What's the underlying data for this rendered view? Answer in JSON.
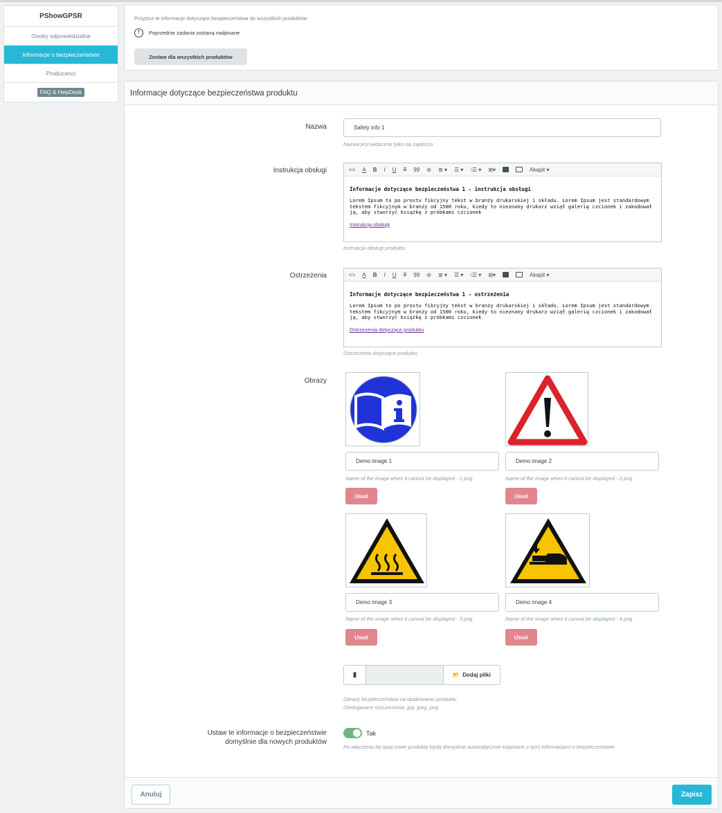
{
  "sidebar": {
    "brand": "PShowGPSR",
    "items": [
      {
        "label": "Osoby odpowiedzialne"
      },
      {
        "label": "Informacje o bezpieczeństwie",
        "active": true
      },
      {
        "label": "Producenci"
      }
    ],
    "faq": "FAQ & HelpDesk"
  },
  "top_card": {
    "info": "Przypisz te informacje dotyczące bezpieczeństwa do wszystkich produktów",
    "warning": "Poprzednie zadania zostaną nadpisane",
    "button": "Zestaw dla wszystkich produktów"
  },
  "form": {
    "title": "Informacje dotyczące bezpieczeństwa produktu",
    "name": {
      "label": "Nazwa",
      "value": "Safety info 1",
      "help": "Nazwa jest widoczna tylko na zapleczu"
    },
    "toolbar": {
      "code": "<>",
      "color": "A",
      "bold": "B",
      "italic": "I",
      "underline": "U",
      "strike": "T",
      "quote": "99",
      "link": "⊖",
      "align": "≣ ▾",
      "ul": "☰ ▾",
      "ol": "⁝☰ ▾",
      "table": "⊞▾",
      "paragraph": "Akapit ▾"
    },
    "instructions": {
      "label": "Instrukcja obsługi",
      "heading": "Informacje dotyczące bezpieczeństwa 1 - instrukcja obsługi",
      "text": "Lorem Ipsum to po prostu fikcyjny tekst w branży drukarskiej i składu. Lorem Ipsum jest standardowym tekstem fikcyjnym w branży od 1500 roku, kiedy to nieznany drukarz wziął galerię czcionek i zakodował ją, aby stworzyć książkę z próbkami czcionek",
      "link": "Instrukcja obsługi",
      "help": "Instrukcja obsługi produktu"
    },
    "warnings": {
      "label": "Ostrzeżenia",
      "heading": "Informacje dotyczące bezpieczeństwa 1 - ostrzeżenia",
      "text": "Lorem Ipsum to po prostu fikcyjny tekst w branży drukarskiej i składu. Lorem Ipsum jest standardowym tekstem fikcyjnym w branży od 1500 roku, kiedy to nieznany drukarz wziął galerię czcionek i zakodował ją, aby stworzyć książkę z próbkami czcionek",
      "link": "Ostrzeżenia dotyczące produktu",
      "help": "Ostrzeżenia dotyczące produktu"
    },
    "images": {
      "label": "Obrazy",
      "delete_label": "Usuń",
      "items": [
        {
          "alt": "Demo image 1",
          "help": "Name of the image when it cannot be displayed - 1.png",
          "icon": "manual-info-icon"
        },
        {
          "alt": "Demo image 2",
          "help": "Name of the image when it cannot be displayed - 2.png",
          "icon": "warning-triangle-icon"
        },
        {
          "alt": "Demo image 3",
          "help": "Name of the image when it cannot be displayed - 3.png",
          "icon": "hot-surface-icon"
        },
        {
          "alt": "Demo image 4",
          "help": "Name of the image when it cannot be displayed - 4.png",
          "icon": "hand-crush-icon"
        }
      ],
      "add_files": "Dodaj pliki",
      "help_1": "Obrazy bezpieczeństwa na opakowaniu produktu",
      "help_2": "Obsługiwane rozszerzenia: jpg, jpeg, png"
    },
    "default": {
      "label_1": "Ustaw te informacje o bezpieczeństwie",
      "label_2": "domyślnie dla nowych produktów",
      "value": true,
      "value_label": "Tak",
      "help": "Po włączeniu tej opcji nowe produkty będą domyślnie automatycznie kojarzone z tymi informacjami o bezpieczeństwie"
    },
    "cancel": "Anuluj",
    "save": "Zapisz"
  },
  "colors": {
    "accent": "#25b9d7",
    "danger_button": "#e0868f",
    "toggle_on": "#70b580"
  }
}
